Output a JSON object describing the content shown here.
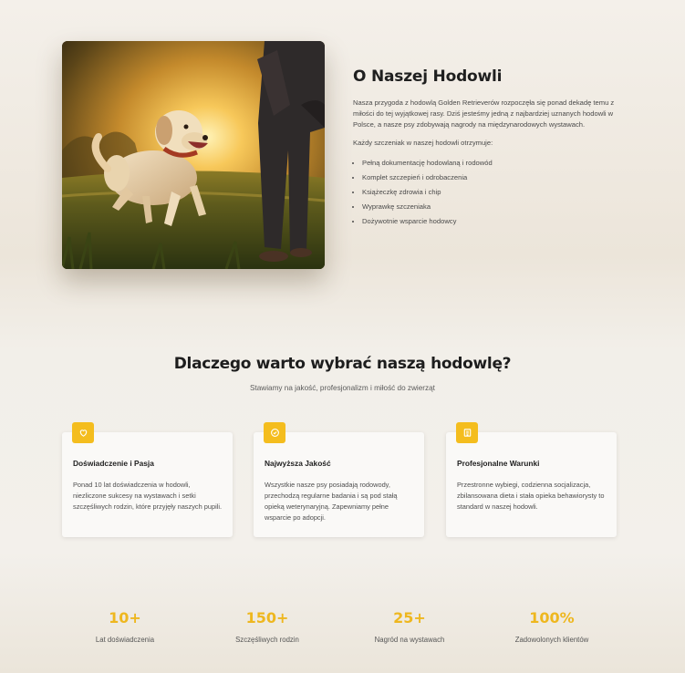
{
  "about": {
    "title": "O Naszej Hodowli",
    "paragraph1": "Nasza przygoda z hodowlą Golden Retrieverów rozpoczęła się ponad dekadę temu z miłości do tej wyjątkowej rasy. Dziś jesteśmy jedną z najbardziej uznanych hodowli w Polsce, a nasze psy zdobywają nagrody na międzynarodowych wystawach.",
    "paragraph2": "Każdy szczeniak w naszej hodowli otrzymuje:",
    "list": [
      "Pełną dokumentację hodowlaną i rodowód",
      "Komplet szczepień i odrobaczenia",
      "Książeczkę zdrowia i chip",
      "Wyprawkę szczeniaka",
      "Dożywotnie wsparcie hodowcy"
    ]
  },
  "why": {
    "title": "Dlaczego warto wybrać naszą hodowlę?",
    "subtitle": "Stawiamy na jakość, profesjonalizm i miłość do zwierząt",
    "cards": [
      {
        "icon": "heart-icon",
        "title": "Doświadczenie i Pasja",
        "text": "Ponad 10 lat doświadczenia w hodowli, niezliczone sukcesy na wystawach i setki szczęśliwych rodzin, które przyjęły naszych pupili."
      },
      {
        "icon": "badge-check-icon",
        "title": "Najwyższa Jakość",
        "text": "Wszystkie nasze psy posiadają rodowody, przechodzą regularne badania i są pod stałą opieką weterynaryjną. Zapewniamy pełne wsparcie po adopcji."
      },
      {
        "icon": "home-icon",
        "title": "Profesjonalne Warunki",
        "text": "Przestronne wybiegi, codzienna socjalizacja, zbilansowana dieta i stała opieka behawiorysty to standard w naszej hodowli."
      }
    ]
  },
  "stats": [
    {
      "value": "10+",
      "label": "Lat doświadczenia"
    },
    {
      "value": "150+",
      "label": "Szczęśliwych rodzin"
    },
    {
      "value": "25+",
      "label": "Nagród na wystawach"
    },
    {
      "value": "100%",
      "label": "Zadowolonych klientów"
    }
  ],
  "colors": {
    "accent": "#f4bd1e",
    "stat_text": "#eeb71f"
  }
}
